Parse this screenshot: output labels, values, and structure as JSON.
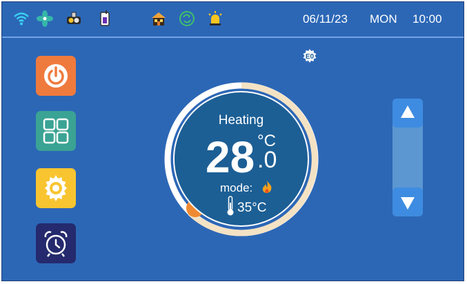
{
  "status_bar": {
    "icons": [
      "wifi-icon",
      "fan-icon",
      "compressor-icon",
      "tank-icon",
      "house-icon",
      "cycle-icon",
      "alarm-light-icon"
    ],
    "date": "06/11/23",
    "weekday": "MON",
    "time": "10:00"
  },
  "sidebar": {
    "buttons": [
      "power-icon",
      "grid-menu-icon",
      "settings-gear-icon",
      "alarm-clock-icon"
    ]
  },
  "error_indicator": {
    "code": "E0",
    "icon": "error-gear-icon"
  },
  "thermostat": {
    "mode": "Heating",
    "setpoint_int": "28",
    "setpoint_dec": ".0",
    "unit": "°C",
    "mode_label": "mode:",
    "mode_icon": "flame-icon",
    "room_temp": "35°C",
    "room_icon": "thermometer-icon"
  },
  "colors": {
    "background": "#2c67b6",
    "power": "#ef7a3e",
    "menu": "#3aa394",
    "settings": "#f8c531",
    "alarm": "#242a6d",
    "dial_fill": "#1c5f95",
    "dial_track": "#f4e2c4",
    "knob": "#ef8a32"
  }
}
